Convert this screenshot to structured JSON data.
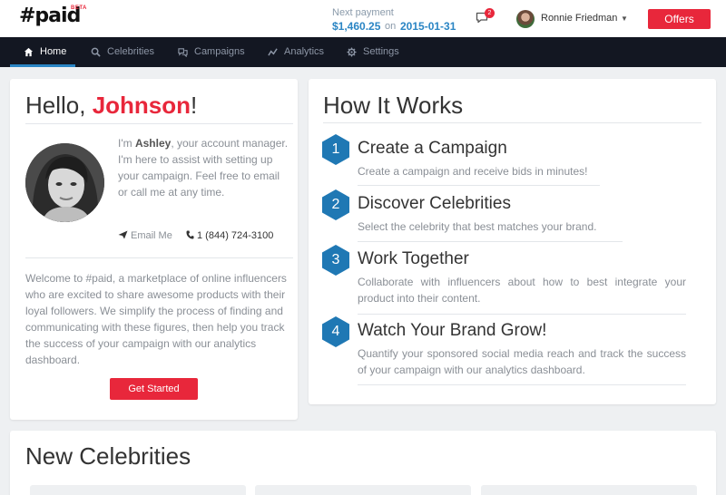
{
  "header": {
    "logo": "#paid",
    "logo_badge": "BETA",
    "payment_label": "Next payment",
    "payment_amount": "$1,460.25",
    "payment_on": "on",
    "payment_date": "2015-01-31",
    "messages_count": "2",
    "user_name": "Ronnie Friedman",
    "offers_label": "Offers"
  },
  "nav": {
    "items": [
      {
        "label": "Home",
        "icon": "home-icon",
        "active": true
      },
      {
        "label": "Celebrities",
        "icon": "search-icon"
      },
      {
        "label": "Campaigns",
        "icon": "campaign-icon"
      },
      {
        "label": "Analytics",
        "icon": "chart-icon"
      },
      {
        "label": "Settings",
        "icon": "gear-icon"
      }
    ]
  },
  "welcome_card": {
    "greeting": "Hello, ",
    "name": "Johnson",
    "exclaim": "!",
    "manager_intro": "I'm ",
    "manager_name": "Ashley",
    "manager_text": ", your account manager. I'm here to assist with setting up your campaign. Feel free to email or call me at any time.",
    "email_label": "Email Me",
    "phone": "1 (844) 724-3100",
    "welcome_text": "Welcome to #paid, a marketplace of online influencers who are excited to share awesome products with their loyal followers. We simplify the process of finding and communicating with these figures, then help you track the success of your campaign with our analytics dashboard.",
    "cta_label": "Get Started"
  },
  "how_it_works": {
    "title": "How It Works",
    "steps": [
      {
        "num": "1",
        "title": "Create a Campaign",
        "desc": "Create a campaign and receive bids in minutes!"
      },
      {
        "num": "2",
        "title": "Discover Celebrities",
        "desc": "Select the celebrity that best matches your brand."
      },
      {
        "num": "3",
        "title": "Work Together",
        "desc": "Collaborate with influencers about how to best integrate your product into their content."
      },
      {
        "num": "4",
        "title": "Watch Your Brand Grow!",
        "desc": "Quantify your sponsored social media reach and track the success of your campaign with our analytics dashboard."
      }
    ]
  },
  "new_celebrities": {
    "title": "New Celebrities"
  },
  "colors": {
    "brand_red": "#e8273b",
    "accent_blue": "#2a85c4",
    "nav_bg": "#131722"
  }
}
